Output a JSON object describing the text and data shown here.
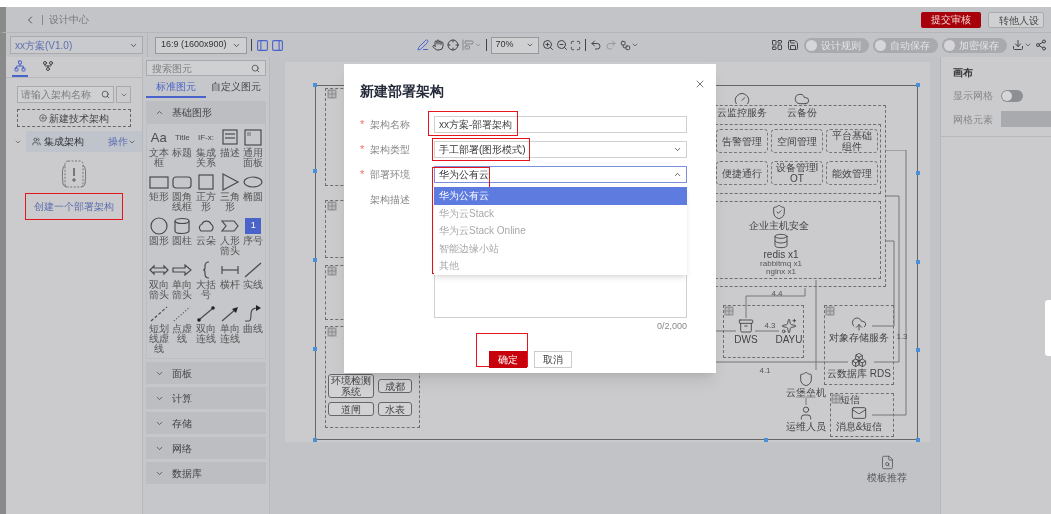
{
  "header": {
    "title": "设计中心",
    "buttons": [
      {
        "label": "提交审核",
        "kind": "primary"
      },
      {
        "label": "转他人设",
        "kind": "default"
      }
    ]
  },
  "toolbar": {
    "scheme_select": "xx方案(V1.0)",
    "ratio_select": "16:9 (1600x900)",
    "zoom_select": "70%",
    "toggles": [
      {
        "label": "设计规则",
        "on": false
      },
      {
        "label": "自动保存",
        "on": false
      },
      {
        "label": "加密保存",
        "on": false
      }
    ]
  },
  "left_panel": {
    "tabs": [
      {
        "selected": true
      },
      {
        "selected": false
      }
    ],
    "search": {
      "placeholder": "请输入架构名称"
    },
    "new_button": "新建技术架构",
    "tree": [
      {
        "label": "集成架构",
        "action": "操作",
        "expanded": true
      }
    ],
    "create_link": {
      "label": "创建一个部署架构",
      "annotated": true
    }
  },
  "palette": {
    "search": {
      "placeholder": "搜索图元"
    },
    "tabs": [
      {
        "label": "标准图元",
        "selected": true
      },
      {
        "label": "自定义图元",
        "selected": false
      }
    ],
    "sections": [
      {
        "title": "基础图形",
        "expanded": true,
        "items": [
          {
            "label": "文本框",
            "kind": "glyph",
            "glyph": "Aa"
          },
          {
            "label": "标题",
            "kind": "glyph",
            "glyph": "Title"
          },
          {
            "label": "集成关系",
            "kind": "glyph",
            "glyph": "IF-x:"
          },
          {
            "label": "描述",
            "kind": "shape"
          },
          {
            "label": "通用面板",
            "kind": "shape"
          },
          {
            "label": "矩形",
            "kind": "shape"
          },
          {
            "label": "圆角线框",
            "kind": "shape"
          },
          {
            "label": "正方形",
            "kind": "shape"
          },
          {
            "label": "三角形",
            "kind": "shape"
          },
          {
            "label": "椭圆",
            "kind": "shape"
          },
          {
            "label": "圆形",
            "kind": "shape"
          },
          {
            "label": "圆柱",
            "kind": "shape"
          },
          {
            "label": "云朵",
            "kind": "shape"
          },
          {
            "label": "人形箭头",
            "kind": "shape"
          },
          {
            "label": "序号",
            "kind": "badge",
            "glyph": "1"
          },
          {
            "label": "双向箭头",
            "kind": "shape"
          },
          {
            "label": "单向箭头",
            "kind": "shape"
          },
          {
            "label": "大括号",
            "kind": "shape"
          },
          {
            "label": "横杆",
            "kind": "shape"
          },
          {
            "label": "实线",
            "kind": "shape"
          },
          {
            "label": "短划线虚线",
            "kind": "shape"
          },
          {
            "label": "点虚线",
            "kind": "shape"
          },
          {
            "label": "双向连线",
            "kind": "shape"
          },
          {
            "label": "单向连线",
            "kind": "shape"
          },
          {
            "label": "曲线",
            "kind": "shape"
          }
        ]
      },
      {
        "title": "面板",
        "expanded": false
      },
      {
        "title": "计算",
        "expanded": false
      },
      {
        "title": "存储",
        "expanded": false
      },
      {
        "title": "网络",
        "expanded": false
      },
      {
        "title": "数据库",
        "expanded": false
      }
    ]
  },
  "canvas": {
    "nodes": [
      {
        "kind": "service",
        "label": "云监控服务"
      },
      {
        "kind": "service",
        "label": "云备份"
      },
      {
        "kind": "module",
        "label": "告警管理"
      },
      {
        "kind": "module",
        "label": "空间管理"
      },
      {
        "kind": "module",
        "label": "平台基础组件"
      },
      {
        "kind": "module",
        "label": "便捷通行"
      },
      {
        "kind": "module",
        "label": "设备管理IOT"
      },
      {
        "kind": "module",
        "label": "能效管理"
      },
      {
        "kind": "service",
        "label": "企业主机安全"
      },
      {
        "kind": "service",
        "label": "redis x1"
      },
      {
        "kind": "note",
        "label": "rabbitmq x1"
      },
      {
        "kind": "note",
        "label": "nginx x1"
      },
      {
        "kind": "note",
        "label": "4.4"
      },
      {
        "kind": "service",
        "label": "DWS"
      },
      {
        "kind": "note",
        "label": "4.3"
      },
      {
        "kind": "service",
        "label": "DAYU"
      },
      {
        "kind": "service",
        "label": "对象存储服务"
      },
      {
        "kind": "note",
        "label": "1.3"
      },
      {
        "kind": "note",
        "label": "4.1"
      },
      {
        "kind": "service",
        "label": "云数据库 RDS"
      },
      {
        "kind": "service",
        "label": "云堡垒机"
      },
      {
        "kind": "title",
        "label": "短信"
      },
      {
        "kind": "service",
        "label": "运维人员"
      },
      {
        "kind": "service",
        "label": "消息&短信"
      },
      {
        "kind": "button",
        "label": "环境检测系统"
      },
      {
        "kind": "button",
        "label": "成都"
      },
      {
        "kind": "button",
        "label": "道闸"
      },
      {
        "kind": "button",
        "label": "水表"
      }
    ]
  },
  "properties": {
    "title": "画布",
    "show_grid": {
      "label": "显示网格",
      "on": false
    },
    "grid_element": {
      "label": "网格元素"
    }
  },
  "template_button": "模板推荐",
  "dialog": {
    "title": "新建部署架构",
    "required_mark": "*",
    "fields": [
      {
        "label": "架构名称",
        "required": true,
        "kind": "input",
        "value": "xx方案-部署架构",
        "annotated": true
      },
      {
        "label": "架构类型",
        "required": true,
        "kind": "select",
        "value": "手工部署(图形模式)",
        "expanded": false,
        "annotated": true
      },
      {
        "label": "部署环境",
        "required": true,
        "kind": "select",
        "value": "华为公有云",
        "expanded": true,
        "annotated": true,
        "options": [
          {
            "label": "华为公有云",
            "selected": true
          },
          {
            "label": "华为云Stack",
            "selected": false
          },
          {
            "label": "华为云Stack Online",
            "selected": false
          },
          {
            "label": "智能边缘小站",
            "selected": false
          },
          {
            "label": "其他",
            "selected": false
          }
        ]
      },
      {
        "label": "架构描述",
        "required": false,
        "kind": "textarea",
        "counter": "0/2,000"
      }
    ],
    "buttons": [
      {
        "label": "确定",
        "kind": "primary",
        "annotated": true
      },
      {
        "label": "取消",
        "kind": "default",
        "annotated": false
      }
    ]
  }
}
